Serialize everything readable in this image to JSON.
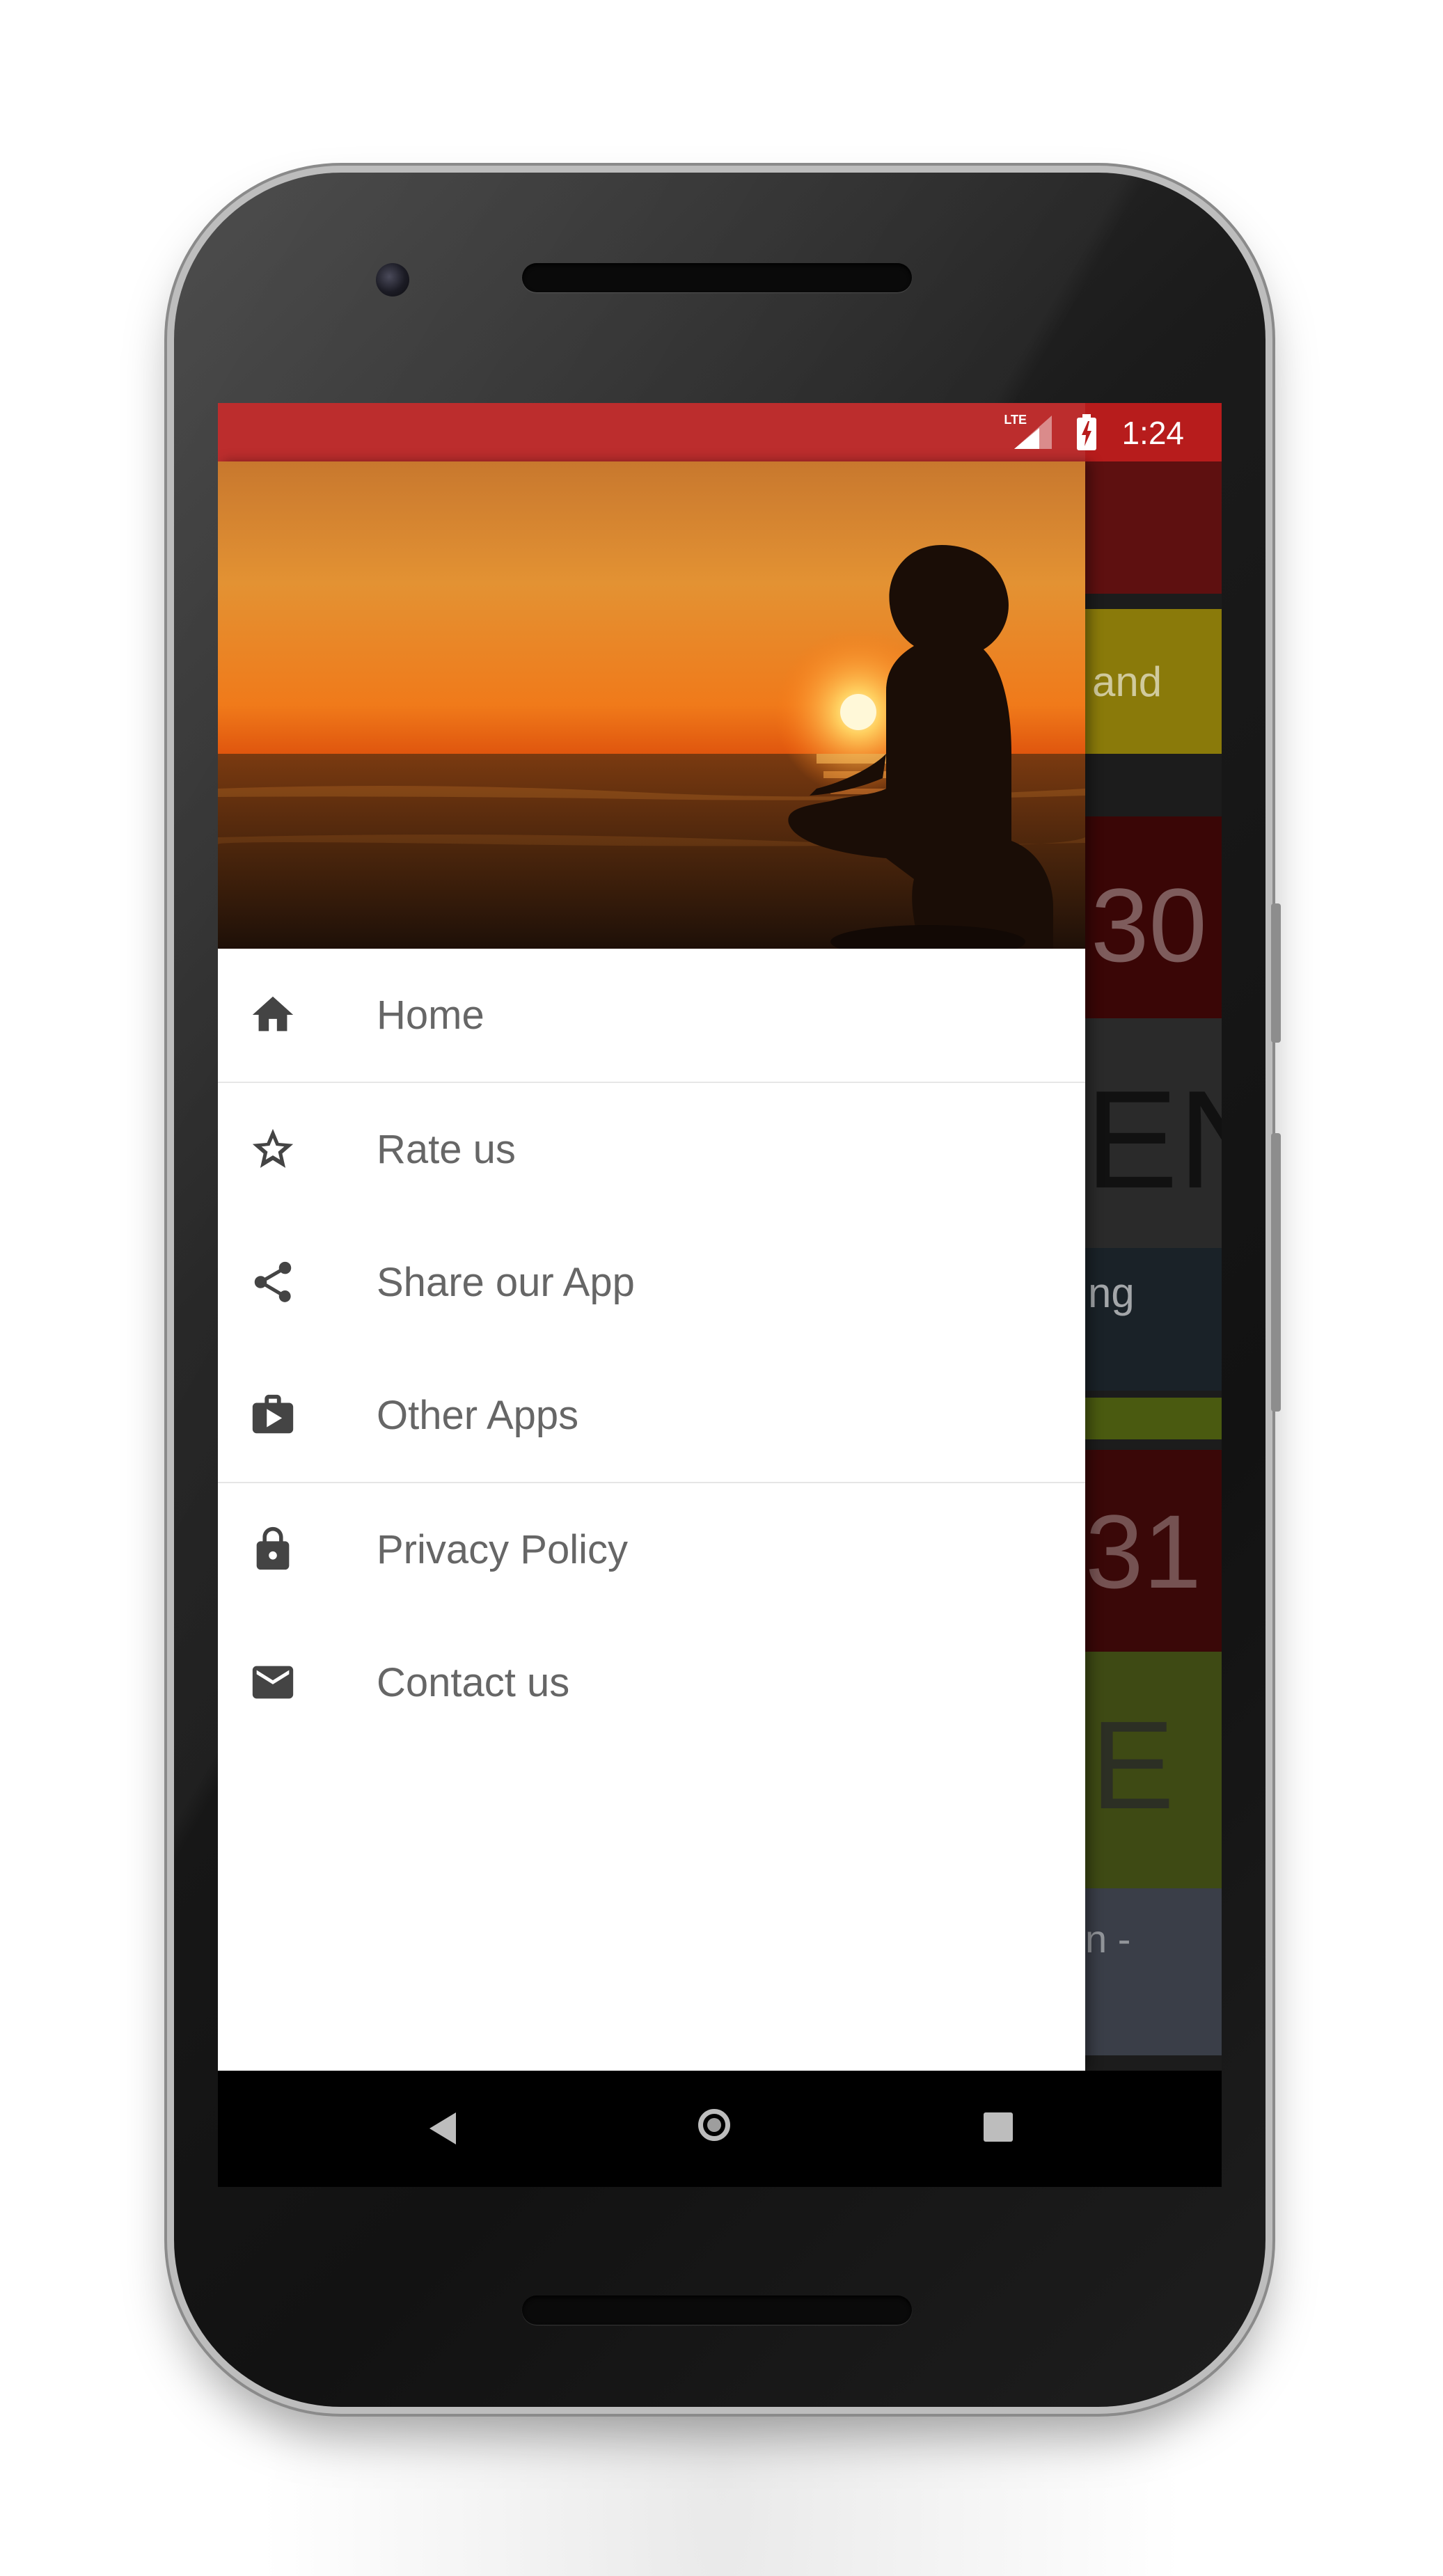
{
  "status_bar": {
    "network": "LTE",
    "time": "1:24"
  },
  "drawer": {
    "menu_items": [
      {
        "label": "Home",
        "icon": "home-icon"
      },
      {
        "label": "Rate us",
        "icon": "star-icon"
      },
      {
        "label": "Share our App",
        "icon": "share-icon"
      },
      {
        "label": "Other Apps",
        "icon": "play-store-icon"
      },
      {
        "label": "Privacy Policy",
        "icon": "lock-icon"
      },
      {
        "label": "Contact us",
        "icon": "email-icon"
      }
    ]
  },
  "background_cards": [
    {
      "text": "and"
    },
    {
      "text": "30"
    },
    {
      "text": "EN"
    },
    {
      "text": "ng"
    },
    {
      "text": "31"
    },
    {
      "text": "E"
    },
    {
      "text": "n -"
    }
  ],
  "colors": {
    "status_bar": "#b71c1c",
    "drawer_text": "#666666",
    "icon": "#444444",
    "nav_bar": "#000000"
  }
}
